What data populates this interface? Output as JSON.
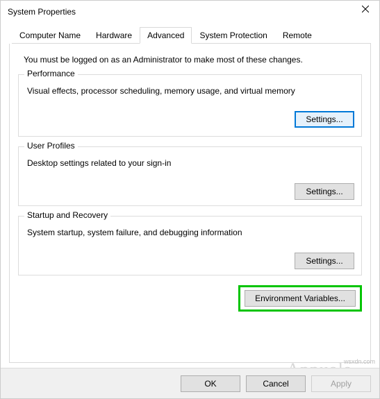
{
  "window": {
    "title": "System Properties"
  },
  "tabs": {
    "computer_name": "Computer Name",
    "hardware": "Hardware",
    "advanced": "Advanced",
    "system_protection": "System Protection",
    "remote": "Remote"
  },
  "intro": "You must be logged on as an Administrator to make most of these changes.",
  "groups": {
    "performance": {
      "legend": "Performance",
      "desc": "Visual effects, processor scheduling, memory usage, and virtual memory",
      "button": "Settings..."
    },
    "user_profiles": {
      "legend": "User Profiles",
      "desc": "Desktop settings related to your sign-in",
      "button": "Settings..."
    },
    "startup": {
      "legend": "Startup and Recovery",
      "desc": "System startup, system failure, and debugging information",
      "button": "Settings..."
    }
  },
  "env_button": "Environment Variables...",
  "footer": {
    "ok": "OK",
    "cancel": "Cancel",
    "apply": "Apply"
  },
  "watermark": "wsxdn.com",
  "bg_text": "Appuals"
}
